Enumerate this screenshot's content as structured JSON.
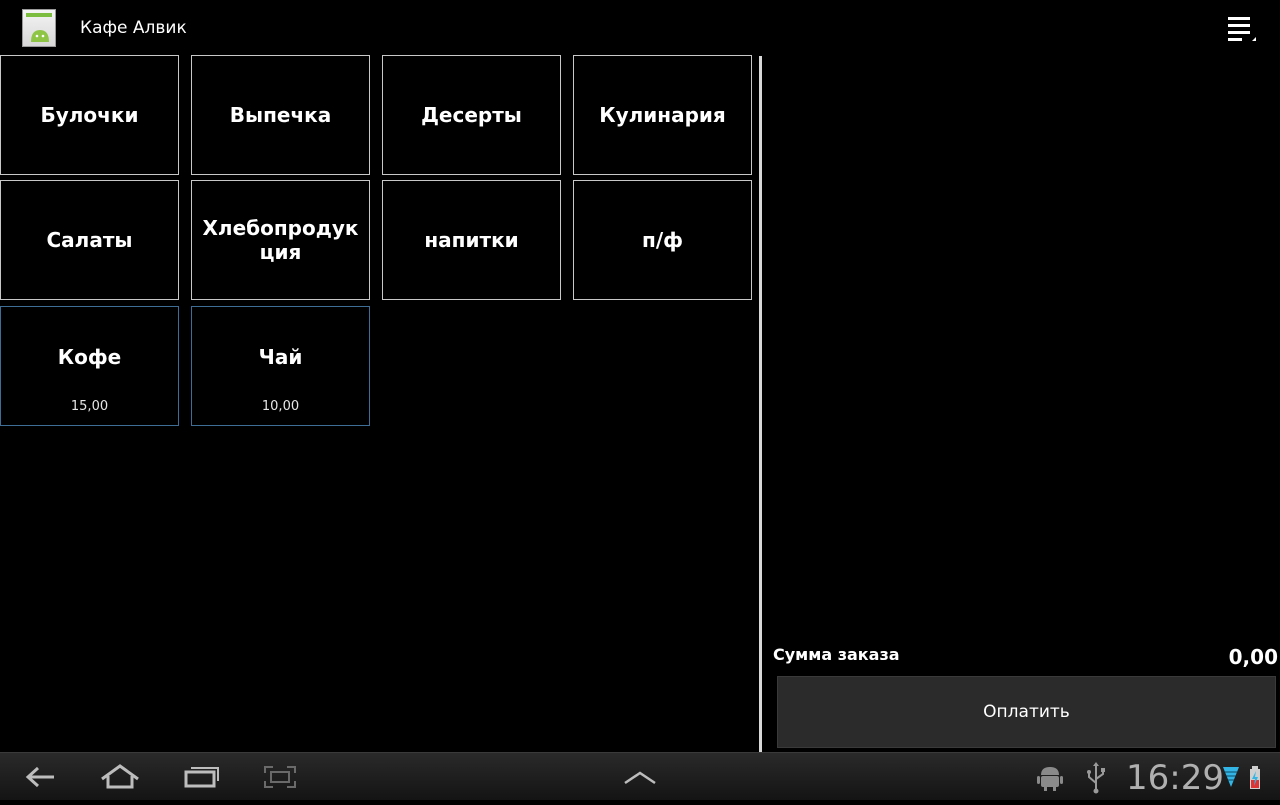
{
  "app": {
    "title": "Кафе Алвик"
  },
  "categories": [
    {
      "label": "Булочки"
    },
    {
      "label": "Выпечка"
    },
    {
      "label": "Десерты"
    },
    {
      "label": "Кулинария"
    },
    {
      "label": "Салаты"
    },
    {
      "label": "Хлебопродукция"
    },
    {
      "label": "напитки"
    },
    {
      "label": "п/ф"
    }
  ],
  "products": [
    {
      "label": "Кофе",
      "price": "15,00"
    },
    {
      "label": "Чай",
      "price": "10,00"
    }
  ],
  "order": {
    "sum_label": "Сумма заказа",
    "sum_value": "0,00",
    "pay_label": "Оплатить"
  },
  "status_bar": {
    "time": "16:29"
  },
  "icons": {
    "app": "app-icon",
    "menu": "overflow-menu-icon",
    "back": "back-icon",
    "home": "home-icon",
    "recents": "recent-apps-icon",
    "screenshot": "screenshot-icon",
    "up": "chevron-up-icon",
    "android": "android-debug-icon",
    "usb": "usb-icon",
    "wifi": "wifi-icon",
    "battery": "battery-charging-icon"
  },
  "colors": {
    "background": "#000000",
    "tile_border": "#c8c8c8",
    "product_border": "#3e6e96",
    "pay_button": "#2b2b2b",
    "wifi": "#33b5e5"
  }
}
